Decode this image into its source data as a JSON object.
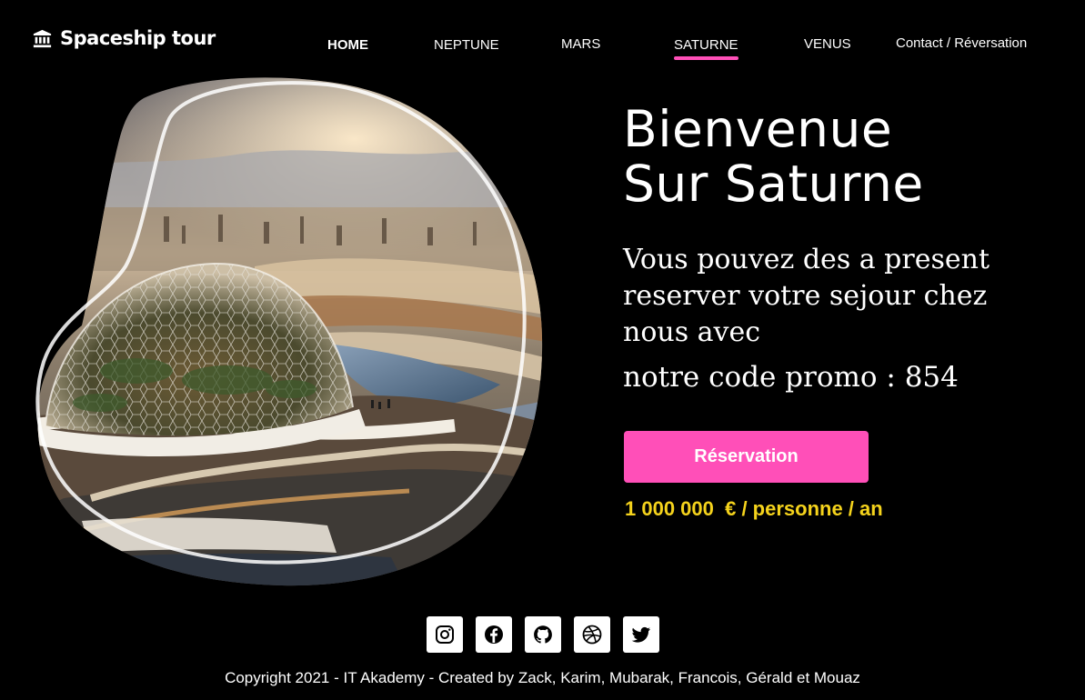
{
  "theme": {
    "accent": "#ff4fb8",
    "price_color": "#f5d31c",
    "background": "#000000"
  },
  "brand": {
    "logo_text": "Spaceship tour",
    "logo_icon": "bank-building-icon"
  },
  "nav": {
    "items": [
      {
        "label": "HOME",
        "active": false
      },
      {
        "label": "NEPTUNE",
        "active": false
      },
      {
        "label": "MARS",
        "active": false
      },
      {
        "label": "SATURNE",
        "active": true
      },
      {
        "label": "VENUS",
        "active": false
      },
      {
        "label": "Contact / Réversation",
        "active": false
      }
    ]
  },
  "hero": {
    "image_icon": "futuristic-dome-city-image",
    "title_line1": "Bienvenue",
    "title_line2": "Sur Saturne",
    "subtitle": "Vous pouvez des a present reserver votre sejour chez nous avec",
    "promo": "notre code promo : 854",
    "button_label": "Réservation",
    "price": "1 000 000  € / personne / an"
  },
  "footer": {
    "socials": [
      {
        "name": "instagram-icon"
      },
      {
        "name": "facebook-icon"
      },
      {
        "name": "github-icon"
      },
      {
        "name": "dribbble-icon"
      },
      {
        "name": "twitter-icon"
      }
    ],
    "copyright": "Copyright 2021 - IT Akademy - Created by Zack, Karim, Mubarak, Francois, Gérald et Mouaz"
  }
}
